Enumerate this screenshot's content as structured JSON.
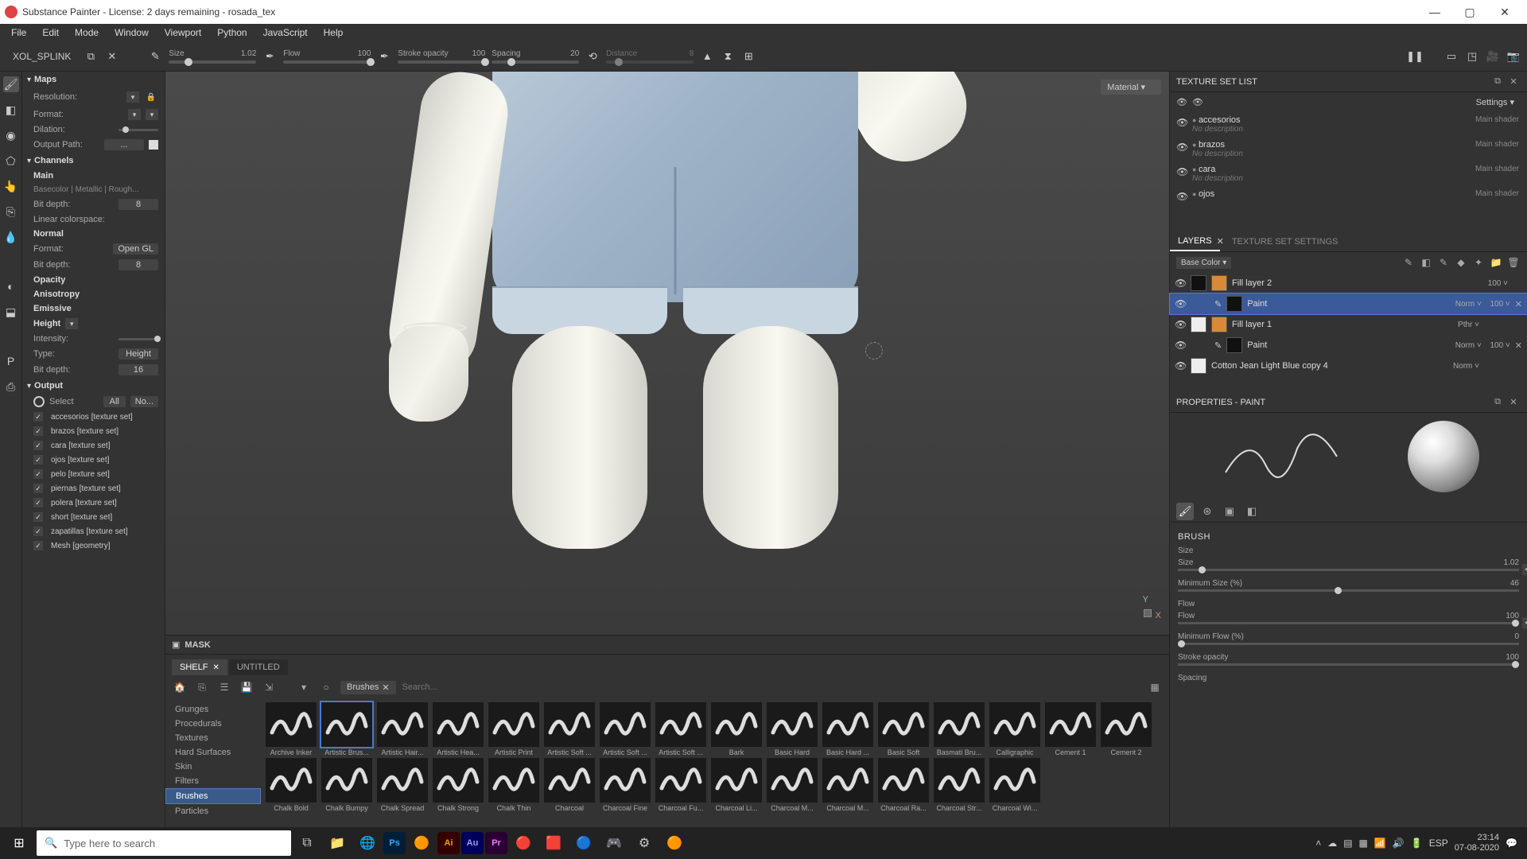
{
  "title": "Substance Painter - License: 2 days remaining - rosada_tex",
  "menu": [
    "File",
    "Edit",
    "Mode",
    "Window",
    "Viewport",
    "Python",
    "JavaScript",
    "Help"
  ],
  "tb": {
    "panel": "XOL_SPLINK",
    "size_l": "Size",
    "size_v": "1.02",
    "flow_l": "Flow",
    "flow_v": "100",
    "opac_l": "Stroke opacity",
    "opac_v": "100",
    "spac_l": "Spacing",
    "spac_v": "20",
    "dist_l": "Distance",
    "dist_v": "8",
    "mat_dd": "Material"
  },
  "maps": {
    "hd": "Maps",
    "res": "Resolution:",
    "fmt": "Format:",
    "dil": "Dilation:",
    "out": "Output Path:",
    "out_v": "..."
  },
  "channels": {
    "hd": "Channels",
    "main": "Main",
    "sub": "Basecolor | Metallic | Rough...",
    "bit": "Bit depth:",
    "bit_v": "8",
    "lin": "Linear colorspace:",
    "normal": "Normal",
    "fmt": "Format:",
    "fmt_v": "Open GL",
    "nbit": "Bit depth:",
    "nbit_v": "8",
    "opac": "Opacity",
    "aniso": "Anisotropy",
    "emis": "Emissive",
    "height": "Height",
    "int": "Intensity:",
    "type": "Type:",
    "type_v": "Height",
    "hbit": "Bit depth:",
    "hbit_v": "16"
  },
  "output": {
    "hd": "Output",
    "sel": "Select",
    "all": "All",
    "none": "No..."
  },
  "out_items": [
    "accesorios [texture set]",
    "brazos [texture set]",
    "cara [texture set]",
    "ojos [texture set]",
    "pelo [texture set]",
    "piernas [texture set]",
    "polera [texture set]",
    "short [texture set]",
    "zapatillas [texture set]",
    "Mesh [geometry]"
  ],
  "mask": "MASK",
  "shelf": {
    "tab1": "SHELF",
    "tab2": "UNTITLED",
    "chip": "Brushes",
    "search_ph": "Search...",
    "cats": [
      "Grunges",
      "Procedurals",
      "Textures",
      "Hard Surfaces",
      "Skin",
      "Filters",
      "Brushes",
      "Particles"
    ]
  },
  "brushes_r1": [
    "Archive Inker",
    "Artistic Brus...",
    "Artistic Hair...",
    "Artistic Hea...",
    "Artistic Print",
    "Artistic Soft ...",
    "Artistic Soft ...",
    "Artistic Soft ...",
    "Bark",
    "Basic Hard",
    "Basic Hard ...",
    "Basic Soft",
    "Basmati Bru...",
    "Calligraphic",
    "Cement 1"
  ],
  "brushes_r2": [
    "Cement 2",
    "Chalk Bold",
    "Chalk Bumpy",
    "Chalk Spread",
    "Chalk Strong",
    "Chalk Thin",
    "Charcoal",
    "Charcoal Fine",
    "Charcoal Fu...",
    "Charcoal Li...",
    "Charcoal M...",
    "Charcoal M...",
    "Charcoal Ra...",
    "Charcoal Str...",
    "Charcoal Wi..."
  ],
  "texlist": {
    "hd": "TEXTURE SET LIST",
    "settings": "Settings",
    "items": [
      {
        "n": "accesorios",
        "d": "No description",
        "s": "Main shader"
      },
      {
        "n": "brazos",
        "d": "No description",
        "s": "Main shader"
      },
      {
        "n": "cara",
        "d": "No description",
        "s": "Main shader"
      },
      {
        "n": "ojos",
        "d": "",
        "s": "Main shader"
      }
    ]
  },
  "layers": {
    "tab1": "LAYERS",
    "tab2": "TEXTURE SET SETTINGS",
    "base": "Base Color",
    "items": [
      {
        "n": "Fill layer 2",
        "b": "",
        "o": "100"
      },
      {
        "n": "Paint",
        "b": "Norm",
        "o": "100",
        "sel": true,
        "indent": true
      },
      {
        "n": "Fill layer 1",
        "b": "Pthr",
        "o": ""
      },
      {
        "n": "Paint",
        "b": "Norm",
        "o": "100",
        "indent": true
      },
      {
        "n": "Cotton Jean Light Blue copy 4",
        "b": "Norm",
        "o": ""
      }
    ]
  },
  "props": {
    "hd": "PROPERTIES - PAINT",
    "brush": "BRUSH",
    "size": "Size",
    "size_v": "1.02",
    "size_l": "Size",
    "min": "Minimum Size (%)",
    "min_v": "46",
    "flow_hd": "Flow",
    "flow": "Flow",
    "flow_v": "100",
    "minf": "Minimum Flow (%)",
    "minf_v": "0",
    "sop": "Stroke opacity",
    "sop_v": "100",
    "spc": "Spacing"
  },
  "taskbar": {
    "search": "Type here to search",
    "lang": "ESP",
    "time": "23:14",
    "date": "07-08-2020"
  }
}
